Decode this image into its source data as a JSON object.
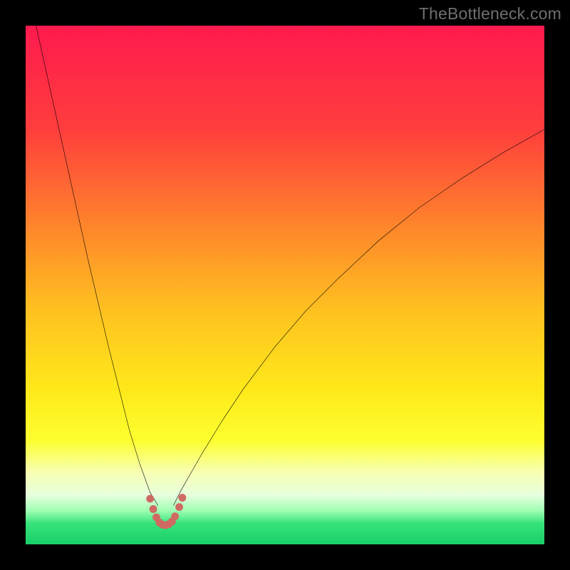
{
  "watermark": "TheBottleneck.com",
  "chart_data": {
    "type": "line",
    "title": "",
    "xlabel": "",
    "ylabel": "",
    "xlim": [
      0,
      100
    ],
    "ylim": [
      0,
      100
    ],
    "gradient_stops": [
      {
        "offset": 0.0,
        "color": "#ff1a4e"
      },
      {
        "offset": 0.2,
        "color": "#ff3e3d"
      },
      {
        "offset": 0.4,
        "color": "#ff8a2a"
      },
      {
        "offset": 0.55,
        "color": "#ffc120"
      },
      {
        "offset": 0.7,
        "color": "#ffe81a"
      },
      {
        "offset": 0.8,
        "color": "#fdff2f"
      },
      {
        "offset": 0.86,
        "color": "#f7ffb0"
      },
      {
        "offset": 0.905,
        "color": "#e8ffde"
      },
      {
        "offset": 0.935,
        "color": "#9fffb3"
      },
      {
        "offset": 0.96,
        "color": "#35e279"
      },
      {
        "offset": 1.0,
        "color": "#19cf6a"
      }
    ],
    "minimum_x": 27,
    "series": [
      {
        "name": "left-curve",
        "color": "#000000",
        "stroke_width": 2,
        "x": [
          2,
          4,
          6,
          8,
          10,
          12,
          14,
          16,
          18,
          20,
          22,
          24,
          25.5
        ],
        "y": [
          100,
          91,
          82,
          73,
          64,
          55,
          46.5,
          38,
          30,
          22,
          15.5,
          10,
          7.5
        ]
      },
      {
        "name": "right-curve",
        "color": "#000000",
        "stroke_width": 2,
        "x": [
          28.5,
          30,
          34,
          38,
          42,
          48,
          54,
          60,
          68,
          76,
          84,
          92,
          100
        ],
        "y": [
          7.5,
          10.5,
          17.5,
          24,
          30,
          38,
          45,
          51,
          58.5,
          65,
          70.5,
          75.5,
          80
        ]
      },
      {
        "name": "trough-marker",
        "color": "#cf6a63",
        "stroke_width": 10,
        "dotted": true,
        "x": [
          24.0,
          24.6,
          25.2,
          25.8,
          26.4,
          27.0,
          27.6,
          28.2,
          28.8,
          29.6,
          30.2
        ],
        "y": [
          8.8,
          6.8,
          5.2,
          4.2,
          3.8,
          3.7,
          3.9,
          4.4,
          5.4,
          7.2,
          9.0
        ]
      }
    ]
  }
}
